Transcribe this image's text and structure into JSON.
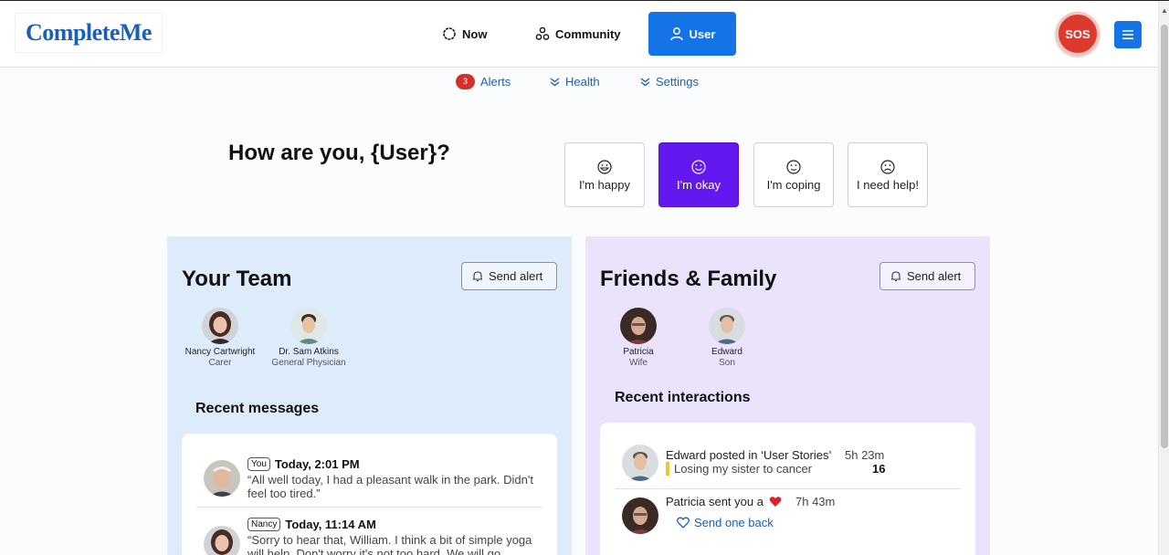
{
  "brand": {
    "logo_text": "CompleteMe",
    "accent": "#1473e6",
    "sos_color": "#dc3a2c",
    "mood_selected": "#6318f0"
  },
  "nav": {
    "now": "Now",
    "community": "Community",
    "user": "User",
    "sos": "SOS"
  },
  "subtabs": {
    "alerts": "Alerts",
    "alerts_count": "3",
    "health": "Health",
    "settings": "Settings"
  },
  "greeting": "How are you, {User}?",
  "moods": {
    "happy": "I'm happy",
    "okay": "I'm okay",
    "coping": "I'm coping",
    "help": "I need help!",
    "selected": "okay"
  },
  "team": {
    "title": "Your Team",
    "send_alert": "Send alert",
    "members": [
      {
        "name": "Nancy Cartwright",
        "role": "Carer"
      },
      {
        "name": "Dr. Sam Atkins",
        "role": "General Physician"
      }
    ],
    "recent_title": "Recent messages",
    "messages": [
      {
        "tag": "You",
        "time": "Today, 2:01 PM",
        "text": "“All well today, I had a pleasant walk in the park. Didn't feel too tired.”"
      },
      {
        "tag": "Nancy",
        "time": "Today, 11:14 AM",
        "text": "“Sorry to hear that, William. I think a bit of simple yoga will help. Don't worry it's not too hard. We will go"
      }
    ]
  },
  "family": {
    "title": "Friends & Family",
    "send_alert": "Send alert",
    "members": [
      {
        "name": "Patricia",
        "role": "Wife"
      },
      {
        "name": "Edward",
        "role": "Son"
      }
    ],
    "recent_title": "Recent interactions",
    "interactions": [
      {
        "line": "Edward posted in ‘User Stories’",
        "time": "5h 23m",
        "sub": "Losing my sister to cancer",
        "count": "16"
      },
      {
        "line": "Patricia sent you a",
        "time": "7h 43m",
        "action": "Send one back"
      }
    ]
  }
}
